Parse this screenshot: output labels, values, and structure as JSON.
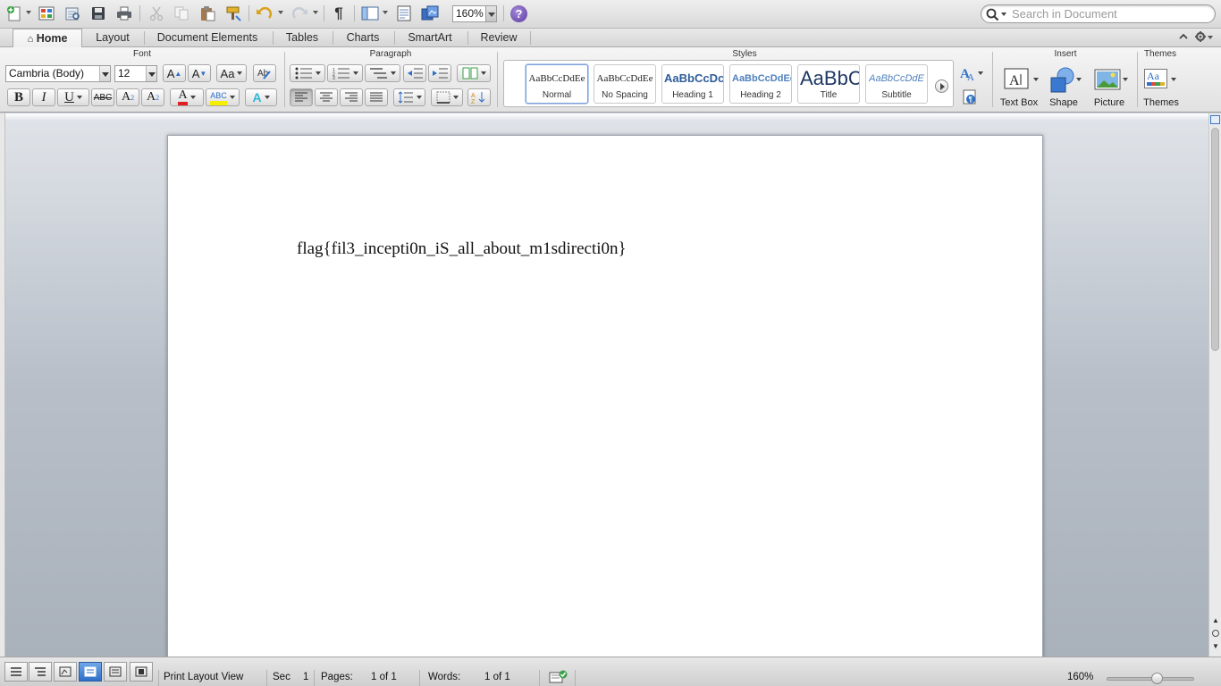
{
  "toolbar": {
    "zoom_value": "160%",
    "search_placeholder": "Search in Document",
    "help_label": "?",
    "icons": [
      "new-document-icon",
      "templates-gallery-icon",
      "open-icon",
      "save-icon",
      "print-icon",
      "cut-icon",
      "copy-icon",
      "paste-icon",
      "format-painter-icon",
      "undo-icon",
      "redo-icon",
      "pilcrow-icon",
      "view-sidebar-icon",
      "toolbox-icon",
      "media-browser-icon",
      "help-icon",
      "search-icon"
    ]
  },
  "tabs": [
    {
      "label": "Home",
      "active": true
    },
    {
      "label": "Layout"
    },
    {
      "label": "Document Elements"
    },
    {
      "label": "Tables"
    },
    {
      "label": "Charts"
    },
    {
      "label": "SmartArt"
    },
    {
      "label": "Review"
    }
  ],
  "ribbon": {
    "groups": {
      "font": "Font",
      "paragraph": "Paragraph",
      "styles": "Styles",
      "insert": "Insert",
      "themes": "Themes"
    },
    "font_name": "Cambria (Body)",
    "font_size": "12",
    "format_buttons": {
      "bold": "B",
      "italic": "I",
      "underline": "U",
      "strikethrough": "ABC",
      "superscript": "A",
      "superscript_mark": "2",
      "subscript": "A",
      "subscript_mark": "2",
      "grow": "A",
      "shrink": "A",
      "change_case": "Aa",
      "font_color": "A",
      "highlight": "ABC",
      "text_effects": "A"
    },
    "styles": [
      {
        "preview": "AaBbCcDdEe",
        "name": "Normal",
        "selected": true
      },
      {
        "preview": "AaBbCcDdEe",
        "name": "No Spacing"
      },
      {
        "preview": "AaBbCcDc",
        "name": "Heading 1"
      },
      {
        "preview": "AaBbCcDdEe",
        "name": "Heading 2"
      },
      {
        "preview": "AaBbC",
        "name": "Title"
      },
      {
        "preview": "AaBbCcDdE",
        "name": "Subtitle"
      }
    ],
    "insert_items": [
      {
        "label": "Text Box",
        "icon": "text-box-icon"
      },
      {
        "label": "Shape",
        "icon": "shape-icon"
      },
      {
        "label": "Picture",
        "icon": "picture-icon"
      }
    ],
    "themes_label": "Themes",
    "themes_preview": "Aa",
    "colors": {
      "font_color": "#e02020",
      "highlight": "#f5ee00",
      "accent": "#2f6fc7"
    }
  },
  "document": {
    "text": "flag{fil3_incepti0n_iS_all_about_m1sdirecti0n}"
  },
  "status": {
    "view_name": "Print Layout View",
    "sec_label": "Sec",
    "sec_value": "1",
    "pages_label": "Pages:",
    "pages_value": "1 of 1",
    "words_label": "Words:",
    "words_value": "1 of 1",
    "zoom": "160%",
    "zoom_level_percent": 160
  }
}
